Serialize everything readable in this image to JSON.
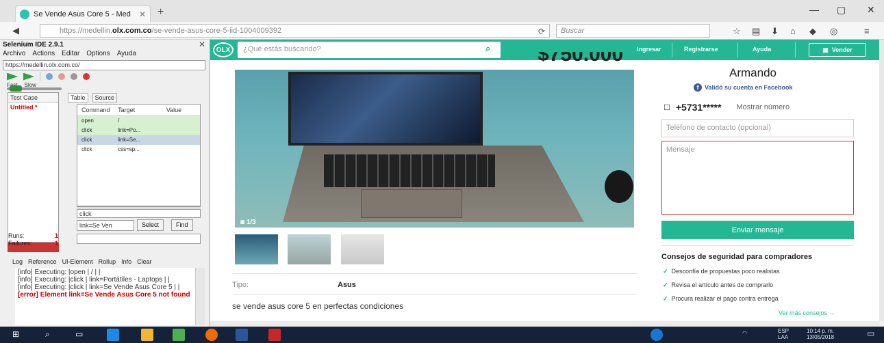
{
  "browser": {
    "tab_title": "Se Vende Asus Core 5 - Med",
    "url_prefix": "https://medellin.",
    "url_domain": "olx.com.co",
    "url_path": "/se-vende-asus-core-5-iid-1004009392",
    "search_placeholder": "Buscar"
  },
  "ide": {
    "title": "Selenium IDE 2.9.1",
    "menu": [
      "Archivo",
      "Actions",
      "Editar",
      "Options",
      "Ayuda"
    ],
    "base_url": "https://medellin.olx.com.co/",
    "speed_fast": "Fast",
    "speed_slow": "Slow",
    "testcase_header": "Test Case",
    "testcase_name": "Untitled *",
    "runs_label": "Runs:",
    "runs_value": "1",
    "failures_label": "Failures:",
    "failures_value": "1",
    "tab_table": "Table",
    "tab_source": "Source",
    "columns": [
      "Command",
      "Target",
      "Value"
    ],
    "commands": [
      {
        "cmd": "open",
        "target": "/",
        "value": ""
      },
      {
        "cmd": "click",
        "target": "link=Po...",
        "value": ""
      },
      {
        "cmd": "click",
        "target": "link=Se...",
        "value": ""
      },
      {
        "cmd": "click",
        "target": "css=sp...",
        "value": ""
      }
    ],
    "command_field": "click",
    "target_field": "link=Se Ven",
    "select_button": "Select",
    "find_button": "Find",
    "log_tabs": [
      "Log",
      "Reference",
      "UI-Element",
      "Rollup",
      "Info",
      "Clear"
    ],
    "log_lines": [
      "[info] Executing: |open | / | |",
      "[info] Executing: |click | link=Portátiles - Laptops | |",
      "[info] Executing: |click | link=Se Vende Asus Core 5 | |"
    ],
    "log_error": "[error] Element link=Se Vende Asus Core 5 not found"
  },
  "olx": {
    "logo": "OLX",
    "search_placeholder": "¿Qué estás buscando?",
    "nav": [
      "Ingresar",
      "Registrarse",
      "Ayuda"
    ],
    "sell_button": "Vender",
    "price_partial": "$750.000",
    "photo_counter": "1/3",
    "tipo_label": "Tipo:",
    "tipo_value": "Asus",
    "description": "se vende asus core 5 en perfectas condiciones",
    "seller_name": "Armando",
    "facebook_verified": "Validó su cuenta en Facebook",
    "phone": "+5731*****",
    "show_number": "Mostrar número",
    "contact_placeholder": "Teléfono de contacto (opcional)",
    "message_placeholder": "Mensaje",
    "send_button": "Enviar mensaje",
    "tips_title": "Consejos de seguridad para compradores",
    "tips": [
      "Desconfía de propuestas poco realistas",
      "Revisa el artículo antes de comprarlo",
      "Procura realizar el pago contra entrega"
    ],
    "tips_more": "Ver más consejos →"
  },
  "taskbar": {
    "lang": "ESP",
    "lang2": "LAA",
    "time": "10:14 p. m.",
    "date": "13/05/2018"
  },
  "colors": {
    "olx_green": "#23b893",
    "taskbar": "#14233a",
    "error_red": "#c00"
  }
}
